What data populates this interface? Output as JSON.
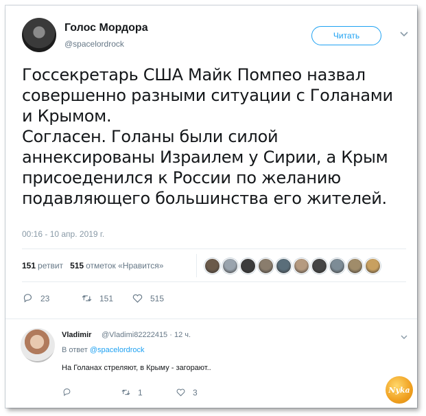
{
  "tweet": {
    "author_name": "Голос Мордора",
    "author_handle": "@spacelordrock",
    "follow_label": "Читать",
    "text": "Госсекретарь США Майк Помпео назвал\nсовершенно разными ситуации с Голанами\nи Крымом.\nСогласен. Голаны были силой\nаннексированы Израилем у Сирии, а Крым\nприсоеденился к России по желанию\nподавляющего большинства его жителей.",
    "timestamp": "00:16 - 10 апр. 2019 г.",
    "retweets_count": "151",
    "retweets_label": "ретвит",
    "likes_count": "515",
    "likes_label": "отметок «Нравится»",
    "actions": {
      "replies": "23",
      "retweets": "151",
      "likes": "515"
    },
    "liker_colors": [
      "#6b5a4a",
      "#9aa4ae",
      "#3c3c3c",
      "#8a7d6d",
      "#5a6e7a",
      "#b59a80",
      "#454545",
      "#7d8c96",
      "#a08c6a",
      "#c8a060"
    ]
  },
  "reply": {
    "author_name": "Vladimir",
    "author_handle": "@Vladimi82222415 · 12 ч.",
    "reply_to_prefix": "В ответ",
    "reply_to_handle": "@spacelordrock",
    "text": "На Голанах стреляют, в Крыму - загорают..",
    "actions": {
      "replies": "",
      "retweets": "1",
      "likes": "3"
    }
  },
  "watermark": {
    "text": "Nyka"
  },
  "colors": {
    "accent": "#1da1f2",
    "muted": "#657786",
    "text": "#14171a"
  }
}
